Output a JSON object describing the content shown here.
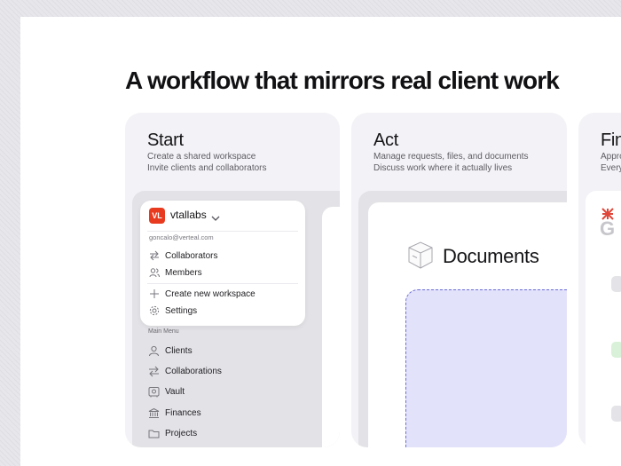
{
  "headline": "A workflow that mirrors real client work",
  "cards": [
    {
      "title": "Start",
      "lines": [
        "Create a shared workspace",
        "Invite clients and collaborators"
      ]
    },
    {
      "title": "Act",
      "lines": [
        "Manage requests, files, and documents",
        "Discuss work where it actually lives"
      ]
    },
    {
      "title": "Fin",
      "lines": [
        "Appro",
        "Every"
      ]
    }
  ],
  "workspace": {
    "badge": "VL",
    "name": "vtallabs",
    "email": "goncalo@verteal.com",
    "menu": [
      "Collaborators",
      "Members",
      "Create new workspace",
      "Settings"
    ],
    "badge_color": "#e83a1f"
  },
  "main_menu": {
    "label": "Main Menu",
    "items": [
      "Clients",
      "Collaborations",
      "Vault",
      "Finances",
      "Projects"
    ]
  },
  "documents": {
    "title": "Documents",
    "accent": "#6b6ed6"
  },
  "finance_preview": {
    "logo_text": "G"
  },
  "icons": {
    "collaborators": "swap-arrows-icon",
    "members": "users-icon",
    "create": "plus-icon",
    "settings": "gear-icon",
    "clients": "user-icon",
    "collaborations": "swap-arrows-icon",
    "vault": "safe-icon",
    "finances": "bank-icon",
    "projects": "folder-icon",
    "documents": "folder-3d-icon"
  }
}
